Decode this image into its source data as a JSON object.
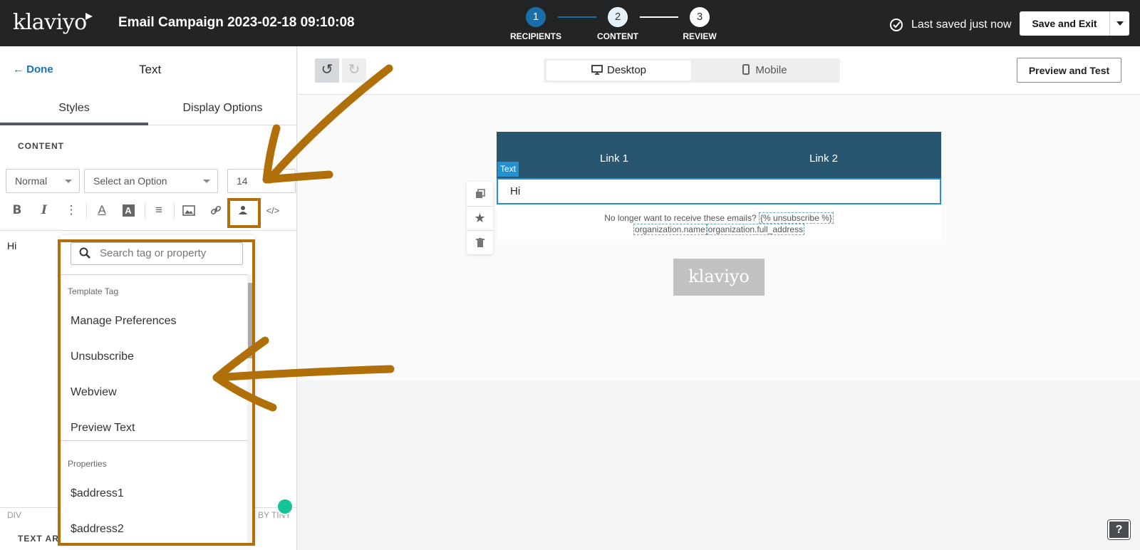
{
  "app": {
    "logo": "klaviyo",
    "campaign_title": "Email Campaign 2023-02-18 09:10:08"
  },
  "steps": [
    {
      "number": "1",
      "label": "RECIPIENTS",
      "state": "complete"
    },
    {
      "number": "2",
      "label": "CONTENT",
      "state": "current"
    },
    {
      "number": "3",
      "label": "REVIEW",
      "state": "upcoming"
    }
  ],
  "header": {
    "saved_text": "Last saved just now",
    "save_exit_label": "Save and Exit"
  },
  "panel": {
    "done_label": "Done",
    "title": "Text",
    "tabs": [
      "Styles",
      "Display Options"
    ],
    "active_tab": "Styles",
    "section_label": "CONTENT",
    "format_select": "Normal",
    "option_select": "Select an Option",
    "font_size": "14",
    "editor_text": "Hi",
    "status_path": "DIV",
    "status_powered": "D BY TINY",
    "textarea_label": "TEXT AREA",
    "toolbar_icons": [
      "bold-icon",
      "italic-icon",
      "more-icon",
      "text-color-icon",
      "background-color-icon",
      "align-icon",
      "image-icon",
      "link-icon",
      "personalize-icon",
      "source-code-icon"
    ]
  },
  "dropdown": {
    "search_placeholder": "Search tag or property",
    "group_template": "Template Tag",
    "template_items": [
      "Manage Preferences",
      "Unsubscribe",
      "Webview",
      "Preview Text"
    ],
    "group_properties": "Properties",
    "property_items": [
      "$address1",
      "$address2"
    ]
  },
  "canvas": {
    "view_desktop": "Desktop",
    "view_mobile": "Mobile",
    "preview_label": "Preview and Test",
    "links": [
      "Link 1",
      "Link 2"
    ],
    "text_chip": "Text",
    "text_block": "Hi",
    "footer_prefix": "No longer want to receive these emails?",
    "footer_unsub": "{% unsubscribe %}",
    "footer_org_name": "organization.name",
    "footer_org_address": "organization.full_address",
    "badge_logo": "klaviyo",
    "help_label": "?"
  },
  "colors": {
    "topbar": "#232426",
    "step_active": "#1a6fa8",
    "email_header": "#285671",
    "selection_blue": "#2391d0",
    "annotation": "#b06f09"
  }
}
